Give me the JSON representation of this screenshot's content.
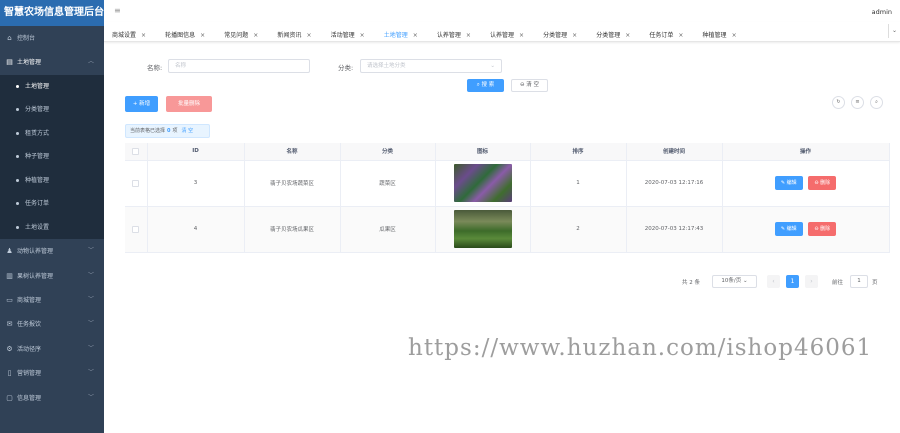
{
  "app": {
    "title": "智慧农场信息管理后台",
    "user": "admin"
  },
  "sidebar": {
    "dashboard": "控制台",
    "land_group": {
      "label": "土地管理",
      "children": [
        "土地管理",
        "分类管理",
        "租赁方式",
        "种子管理",
        "种植管理",
        "任务订单",
        "土地设置"
      ],
      "active_index": 0
    },
    "groups": [
      "动物认养管理",
      "果树认养管理",
      "商城管理",
      "任务报饮",
      "活动径序",
      "营销管理",
      "信息管理"
    ]
  },
  "tabs": {
    "items": [
      "商城设置",
      "轮播图信息",
      "常见问题",
      "新闻资讯",
      "活动管理",
      "土地管理",
      "认养管理",
      "认养管理",
      "分类管理",
      "分类管理",
      "任务订单",
      "种植管理"
    ],
    "active_index": 5,
    "close": "×"
  },
  "filter": {
    "name_label": "名称:",
    "name_placeholder": "名称",
    "category_label": "分类:",
    "category_placeholder": "请选择土地分类",
    "search": "搜 索",
    "reset": "清 空"
  },
  "toolbar": {
    "add": "+ 新增",
    "batch_delete": "批量删除"
  },
  "selection": {
    "prefix": "当前表格已选择",
    "count": "0",
    "suffix": "项",
    "clear": "清 空"
  },
  "table": {
    "columns": [
      "",
      "ID",
      "名称",
      "分类",
      "图标",
      "排序",
      "创建时间",
      "操作"
    ],
    "rows": [
      {
        "id": "3",
        "name": "翡子贝农场蔬菜区",
        "category": "蔬菜区",
        "sort": "1",
        "created": "2020-07-03 12:17:16"
      },
      {
        "id": "4",
        "name": "翡子贝农场瓜果区",
        "category": "瓜果区",
        "sort": "2",
        "created": "2020-07-03 12:17:43"
      }
    ],
    "edit": "编辑",
    "delete": "删除"
  },
  "pagination": {
    "total": "共 2 条",
    "page_size": "10条/页",
    "current": "1",
    "goto_label": "前往",
    "goto_value": "1",
    "page_unit": "页"
  },
  "watermark": "https://www.huzhan.com/ishop46061"
}
